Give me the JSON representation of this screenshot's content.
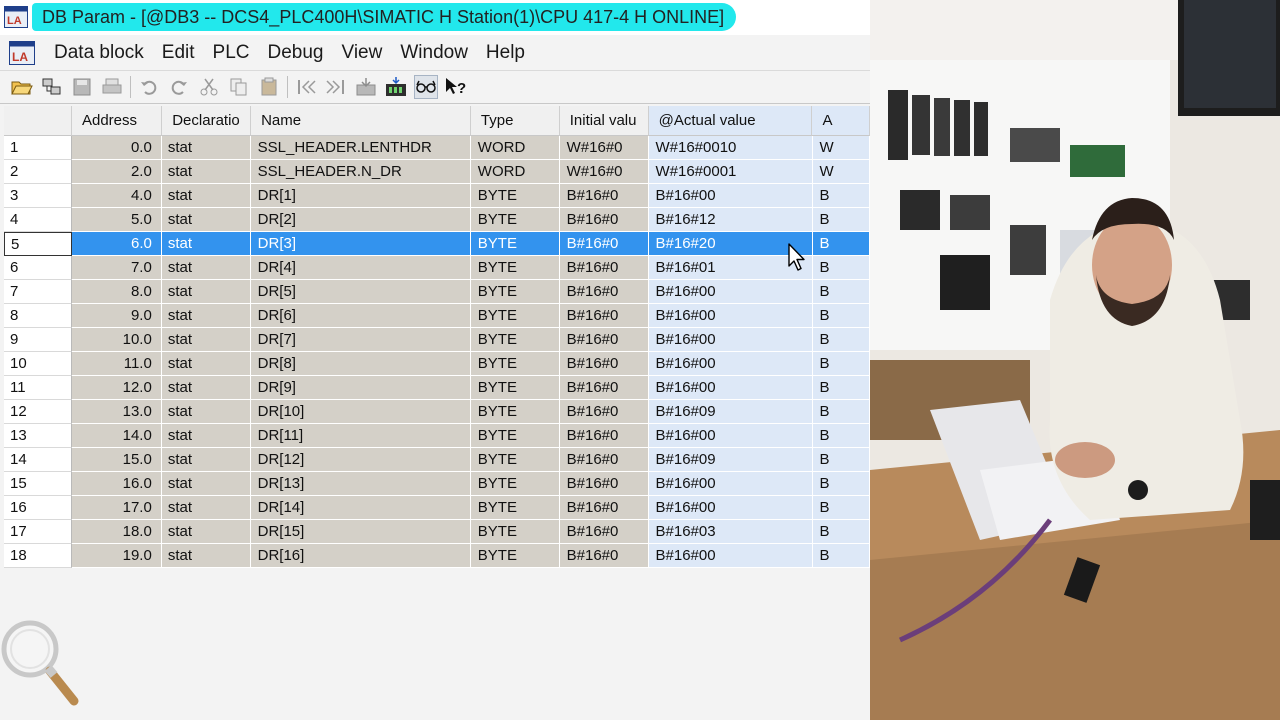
{
  "window": {
    "title": "DB Param - [@DB3 -- DCS4_PLC400H\\SIMATIC H Station(1)\\CPU 417-4 H  ONLINE]",
    "title_highlight_color": "#22e8ec",
    "icon": "ladder-app-icon"
  },
  "menu": {
    "items": [
      "Data block",
      "Edit",
      "PLC",
      "Debug",
      "View",
      "Window",
      "Help"
    ]
  },
  "toolbar": {
    "icons": [
      "open-folder-icon",
      "accessible-nodes-icon",
      "save-icon",
      "print-icon",
      "undo-icon",
      "redo-icon",
      "cut-icon",
      "copy-icon",
      "paste-icon",
      "previous-error-icon",
      "next-error-icon",
      "download-icon",
      "monitor-icon",
      "glasses-icon",
      "help-icon"
    ]
  },
  "table": {
    "columns": [
      "",
      "Address",
      "Declaratio",
      "Name",
      "Type",
      "Initial valu",
      "@Actual value",
      "A"
    ],
    "selected_row": 5,
    "selection_color": "#3393ee",
    "rows": [
      {
        "num": "1",
        "address": "0.0",
        "decl": "stat",
        "name": "SSL_HEADER.LENTHDR",
        "type": "WORD",
        "initial": "W#16#0",
        "actual": "W#16#0010",
        "extra": "W"
      },
      {
        "num": "2",
        "address": "2.0",
        "decl": "stat",
        "name": "SSL_HEADER.N_DR",
        "type": "WORD",
        "initial": "W#16#0",
        "actual": "W#16#0001",
        "extra": "W"
      },
      {
        "num": "3",
        "address": "4.0",
        "decl": "stat",
        "name": "DR[1]",
        "type": "BYTE",
        "initial": "B#16#0",
        "actual": "B#16#00",
        "extra": "B"
      },
      {
        "num": "4",
        "address": "5.0",
        "decl": "stat",
        "name": "DR[2]",
        "type": "BYTE",
        "initial": "B#16#0",
        "actual": "B#16#12",
        "extra": "B"
      },
      {
        "num": "5",
        "address": "6.0",
        "decl": "stat",
        "name": "DR[3]",
        "type": "BYTE",
        "initial": "B#16#0",
        "actual": "B#16#20",
        "extra": "B"
      },
      {
        "num": "6",
        "address": "7.0",
        "decl": "stat",
        "name": "DR[4]",
        "type": "BYTE",
        "initial": "B#16#0",
        "actual": "B#16#01",
        "extra": "B"
      },
      {
        "num": "7",
        "address": "8.0",
        "decl": "stat",
        "name": "DR[5]",
        "type": "BYTE",
        "initial": "B#16#0",
        "actual": "B#16#00",
        "extra": "B"
      },
      {
        "num": "8",
        "address": "9.0",
        "decl": "stat",
        "name": "DR[6]",
        "type": "BYTE",
        "initial": "B#16#0",
        "actual": "B#16#00",
        "extra": "B"
      },
      {
        "num": "9",
        "address": "10.0",
        "decl": "stat",
        "name": "DR[7]",
        "type": "BYTE",
        "initial": "B#16#0",
        "actual": "B#16#00",
        "extra": "B"
      },
      {
        "num": "10",
        "address": "11.0",
        "decl": "stat",
        "name": "DR[8]",
        "type": "BYTE",
        "initial": "B#16#0",
        "actual": "B#16#00",
        "extra": "B"
      },
      {
        "num": "11",
        "address": "12.0",
        "decl": "stat",
        "name": "DR[9]",
        "type": "BYTE",
        "initial": "B#16#0",
        "actual": "B#16#00",
        "extra": "B"
      },
      {
        "num": "12",
        "address": "13.0",
        "decl": "stat",
        "name": "DR[10]",
        "type": "BYTE",
        "initial": "B#16#0",
        "actual": "B#16#09",
        "extra": "B"
      },
      {
        "num": "13",
        "address": "14.0",
        "decl": "stat",
        "name": "DR[11]",
        "type": "BYTE",
        "initial": "B#16#0",
        "actual": "B#16#00",
        "extra": "B"
      },
      {
        "num": "14",
        "address": "15.0",
        "decl": "stat",
        "name": "DR[12]",
        "type": "BYTE",
        "initial": "B#16#0",
        "actual": "B#16#09",
        "extra": "B"
      },
      {
        "num": "15",
        "address": "16.0",
        "decl": "stat",
        "name": "DR[13]",
        "type": "BYTE",
        "initial": "B#16#0",
        "actual": "B#16#00",
        "extra": "B"
      },
      {
        "num": "16",
        "address": "17.0",
        "decl": "stat",
        "name": "DR[14]",
        "type": "BYTE",
        "initial": "B#16#0",
        "actual": "B#16#00",
        "extra": "B"
      },
      {
        "num": "17",
        "address": "18.0",
        "decl": "stat",
        "name": "DR[15]",
        "type": "BYTE",
        "initial": "B#16#0",
        "actual": "B#16#03",
        "extra": "B"
      },
      {
        "num": "18",
        "address": "19.0",
        "decl": "stat",
        "name": "DR[16]",
        "type": "BYTE",
        "initial": "B#16#0",
        "actual": "B#16#00",
        "extra": "B"
      }
    ]
  },
  "overlay": {
    "cursor": "mouse-pointer-icon",
    "magnifier": "magnifier-icon"
  },
  "video_panel": {
    "subject": "presenter-video-feed"
  }
}
